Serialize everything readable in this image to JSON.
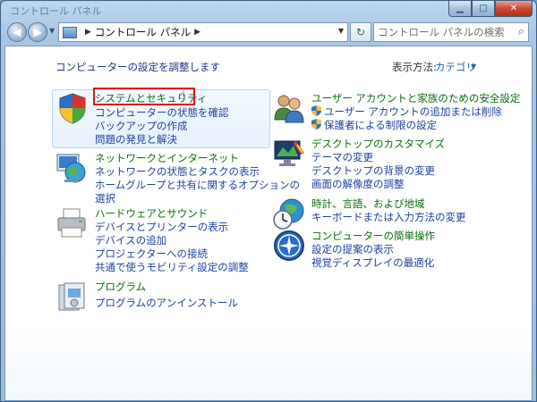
{
  "window": {
    "title": "コントロール パネル"
  },
  "nav": {
    "breadcrumb": "コントロール パネル",
    "search_placeholder": "コントロール パネルの検索"
  },
  "header": {
    "heading": "コンピューターの設定を調整します",
    "view_by_label": "表示方法:",
    "view_by_value": "カテゴリ"
  },
  "categories": {
    "system": {
      "title": "システムとセキュリティ",
      "links": [
        "コンピューターの状態を確認",
        "バックアップの作成",
        "問題の発見と解決"
      ]
    },
    "network": {
      "title": "ネットワークとインターネット",
      "links": [
        "ネットワークの状態とタスクの表示",
        "ホームグループと共有に関するオプションの",
        "選択"
      ]
    },
    "hardware": {
      "title": "ハードウェアとサウンド",
      "links": [
        "デバイスとプリンターの表示",
        "デバイスの追加",
        "プロジェクターへの接続",
        "共通で使うモビリティ設定の調整"
      ]
    },
    "programs": {
      "title": "プログラム",
      "links": [
        "プログラムのアンインストール"
      ]
    },
    "users": {
      "title": "ユーザー アカウントと家族のための安全設定",
      "links": [
        "ユーザー アカウントの追加または削除",
        "保護者による制限の設定"
      ]
    },
    "appearance": {
      "title": "デスクトップのカスタマイズ",
      "links": [
        "テーマの変更",
        "デスクトップの背景の変更",
        "画面の解像度の調整"
      ]
    },
    "clock": {
      "title": "時計、言語、および地域",
      "links": [
        "キーボードまたは入力方法の変更"
      ]
    },
    "ease": {
      "title": "コンピューターの簡単操作",
      "links": [
        "設定の提案の表示",
        "視覚ディスプレイの最適化"
      ]
    }
  },
  "colors": {
    "category_title": "#0a6e0a",
    "link": "#1c3fa3",
    "highlight": "#e1141b"
  },
  "icons": {
    "system": "shield-icon",
    "network": "globe-network-icon",
    "hardware": "printer-icon",
    "programs": "programs-box-icon",
    "users": "users-icon",
    "appearance": "monitor-paint-icon",
    "clock": "globe-clock-icon",
    "ease": "accessibility-icon"
  }
}
